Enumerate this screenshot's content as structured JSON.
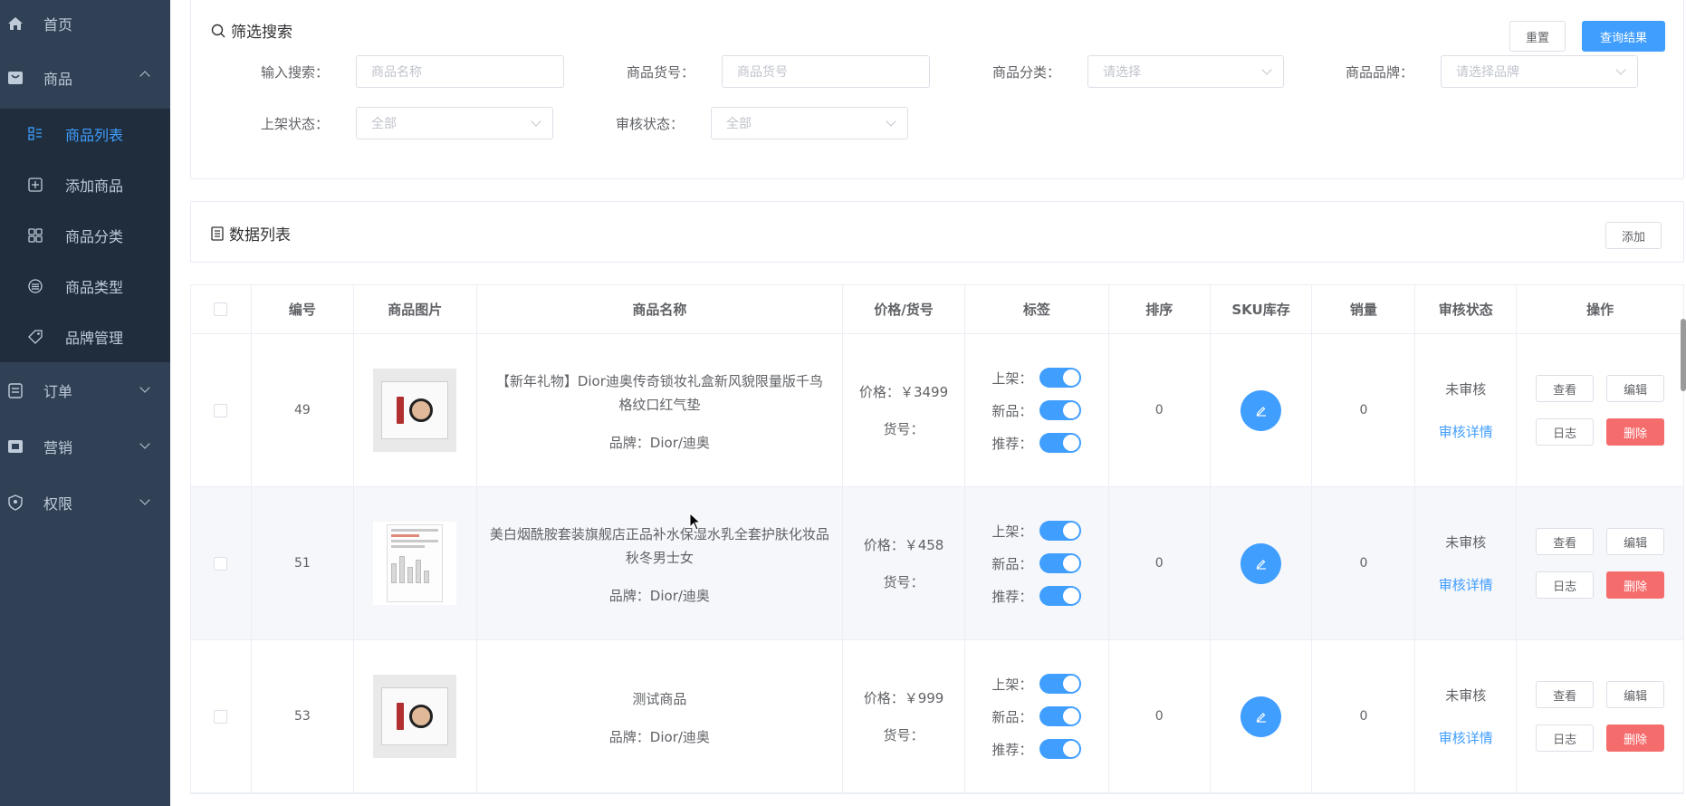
{
  "sidebar": {
    "items": [
      {
        "label": "首页",
        "icon": "home-icon"
      },
      {
        "label": "商品",
        "icon": "goods-icon",
        "expanded": true
      },
      {
        "label": "订单",
        "icon": "order-icon"
      },
      {
        "label": "营销",
        "icon": "marketing-icon"
      },
      {
        "label": "权限",
        "icon": "permission-icon"
      }
    ],
    "sub_items": [
      {
        "label": "商品列表",
        "icon": "list-icon",
        "active": true
      },
      {
        "label": "添加商品",
        "icon": "add-icon"
      },
      {
        "label": "商品分类",
        "icon": "category-icon"
      },
      {
        "label": "商品类型",
        "icon": "type-icon"
      },
      {
        "label": "品牌管理",
        "icon": "tag-icon"
      }
    ]
  },
  "filter": {
    "title": "筛选搜索",
    "reset_label": "重置",
    "query_label": "查询结果",
    "fields": [
      {
        "label": "输入搜索：",
        "placeholder": "商品名称"
      },
      {
        "label": "商品货号：",
        "placeholder": "商品货号"
      },
      {
        "label": "商品分类：",
        "placeholder": "请选择"
      },
      {
        "label": "商品品牌：",
        "placeholder": "请选择品牌"
      },
      {
        "label": "上架状态：",
        "placeholder": "全部"
      },
      {
        "label": "审核状态：",
        "placeholder": "全部"
      }
    ]
  },
  "list": {
    "title": "数据列表",
    "add_label": "添加"
  },
  "table": {
    "headers": [
      "",
      "编号",
      "商品图片",
      "商品名称",
      "价格/货号",
      "标签",
      "排序",
      "SKU库存",
      "销量",
      "审核状态",
      "操作"
    ],
    "tag_labels": {
      "on_shelf": "上架：",
      "new": "新品：",
      "recommend": "推荐："
    },
    "price_prefix": "价格：",
    "code_prefix": "货号：",
    "brand_prefix": "品牌：",
    "audit_detail": "审核详情",
    "ops": {
      "view": "查看",
      "edit": "编辑",
      "log": "日志",
      "delete": "删除"
    },
    "rows": [
      {
        "id": "49",
        "name": "【新年礼物】Dior迪奥传奇锁妆礼盒新风貌限量版千鸟格纹口红气垫",
        "brand": "Dior/迪奥",
        "price": "￥3499",
        "code": "",
        "sort": "0",
        "sales": "0",
        "audit": "未审核",
        "image": "cushion-lipstick"
      },
      {
        "id": "51",
        "name": "美白烟酰胺套装旗舰店正品补水保湿水乳全套护肤化妆品秋冬男士女",
        "brand": "Dior/迪奥",
        "price": "￥458",
        "code": "",
        "sort": "0",
        "sales": "0",
        "audit": "未审核",
        "image": "skincare-set"
      },
      {
        "id": "53",
        "name": "测试商品",
        "brand": "Dior/迪奥",
        "price": "￥999",
        "code": "",
        "sort": "0",
        "sales": "0",
        "audit": "未审核",
        "image": "cushion-lipstick"
      }
    ]
  },
  "colors": {
    "primary": "#409eff",
    "danger": "#f56c6c",
    "sidebar": "#304156",
    "submenu": "#1f2d3d"
  }
}
